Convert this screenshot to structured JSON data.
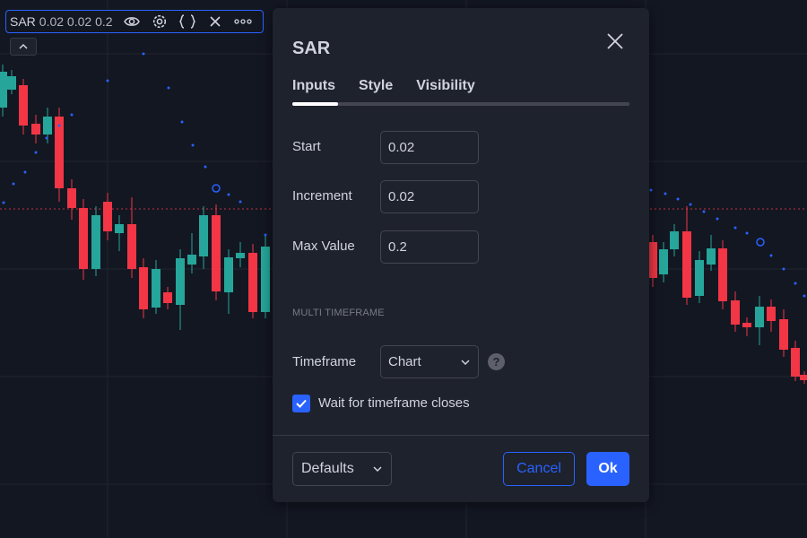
{
  "legend": {
    "name": "SAR",
    "values": "0.02 0.02 0.2",
    "icons": [
      "eye-icon",
      "gear-icon",
      "braces-icon",
      "close-icon",
      "more-icon"
    ]
  },
  "dialog": {
    "title": "SAR",
    "tabs": [
      "Inputs",
      "Style",
      "Visibility"
    ],
    "active_tab": "Inputs",
    "fields": [
      {
        "label": "Start",
        "value": "0.02"
      },
      {
        "label": "Increment",
        "value": "0.02"
      },
      {
        "label": "Max Value",
        "value": "0.2"
      }
    ],
    "section_title": "MULTI TIMEFRAME",
    "timeframe": {
      "label": "Timeframe",
      "selected": "Chart"
    },
    "help_glyph": "?",
    "wait_checkbox": {
      "label": "Wait for timeframe closes",
      "checked": true
    },
    "footer": {
      "defaults_label": "Defaults",
      "cancel_label": "Cancel",
      "ok_label": "Ok"
    }
  },
  "colors": {
    "background": "#131722",
    "panel": "#1e222d",
    "accent": "#2962ff",
    "candle_up": "#26a69a",
    "candle_down": "#f23645",
    "sar_dot": "#2962ff",
    "price_line": "#f23645"
  }
}
